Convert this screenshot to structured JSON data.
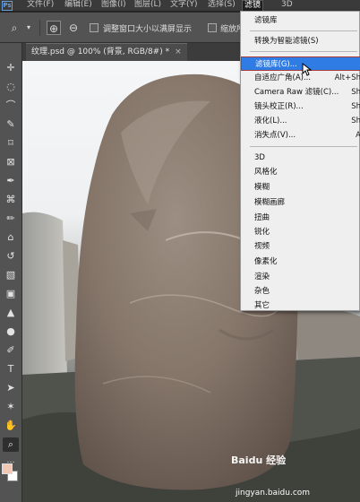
{
  "menubar": {
    "logo": "Ps",
    "items": [
      "文件(F)",
      "编辑(E)",
      "图像(I)",
      "图层(L)",
      "文字(Y)",
      "选择(S)",
      "滤镜",
      "3D"
    ],
    "active_index": 6
  },
  "optbar": {
    "checkbox1_label": "调整窗口大小以满屏显示",
    "checkbox2_label": "缩放所"
  },
  "document_tab": {
    "title": "纹理.psd @ 100% (背景, RGB/8#) *",
    "close": "×"
  },
  "filter_menu": {
    "group1": [
      {
        "label": "滤镜库",
        "shortcut": ""
      }
    ],
    "group2": [
      {
        "label": "转换为智能滤镜(S)",
        "shortcut": ""
      }
    ],
    "group3": [
      {
        "label": "滤镜库(G)...",
        "shortcut": "",
        "highlighted": true
      },
      {
        "label": "自适应广角(A)...",
        "shortcut": "Alt+Sh"
      },
      {
        "label": "Camera Raw 滤镜(C)...",
        "shortcut": "Sh"
      },
      {
        "label": "镜头校正(R)...",
        "shortcut": "Sh"
      },
      {
        "label": "液化(L)...",
        "shortcut": "Sh"
      },
      {
        "label": "消失点(V)...",
        "shortcut": "A"
      }
    ],
    "group4": [
      {
        "label": "3D"
      },
      {
        "label": "风格化"
      },
      {
        "label": "模糊"
      },
      {
        "label": "模糊画廊"
      },
      {
        "label": "扭曲"
      },
      {
        "label": "锐化"
      },
      {
        "label": "视频"
      },
      {
        "label": "像素化"
      },
      {
        "label": "渲染"
      },
      {
        "label": "杂色"
      },
      {
        "label": "其它"
      }
    ]
  },
  "colors": {
    "foreground": "#f2c8b4",
    "background": "#ffffff",
    "highlight": "#2e7ce4"
  },
  "watermark": {
    "brand": "Baidu 经验",
    "url": "jingyan.baidu.com"
  }
}
